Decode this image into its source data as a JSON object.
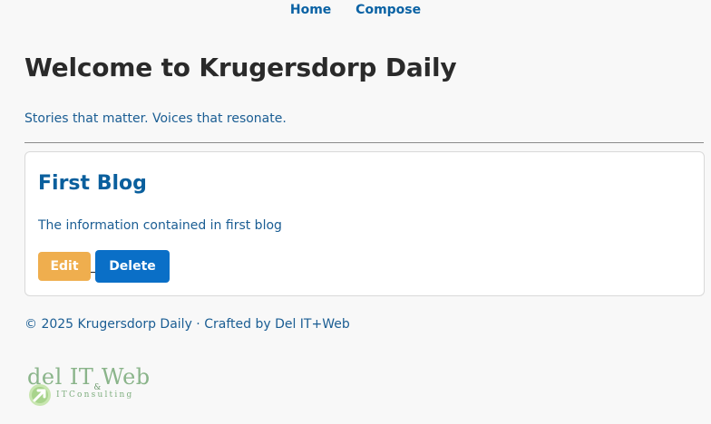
{
  "nav": {
    "home": "Home",
    "compose": "Compose"
  },
  "header": {
    "title": "Welcome to Krugersdorp Daily",
    "tagline": "Stories that matter. Voices that resonate."
  },
  "posts": [
    {
      "title": "First Blog",
      "body": "The information contained in first blog",
      "edit_label": "Edit",
      "delete_label": "Delete"
    }
  ],
  "footer": {
    "text": "© 2025 Krugersdorp Daily · Crafted by Del IT+Web"
  },
  "logo": {
    "main": "del IT",
    "amp": "&",
    "web": "Web",
    "sub": "ITConsulting",
    "icon": "arrow-up-right-icon"
  },
  "colors": {
    "link": "#0a62a4",
    "edit": "#efae4e",
    "delete": "#0a6fc7",
    "logo": "#8ab48a"
  }
}
